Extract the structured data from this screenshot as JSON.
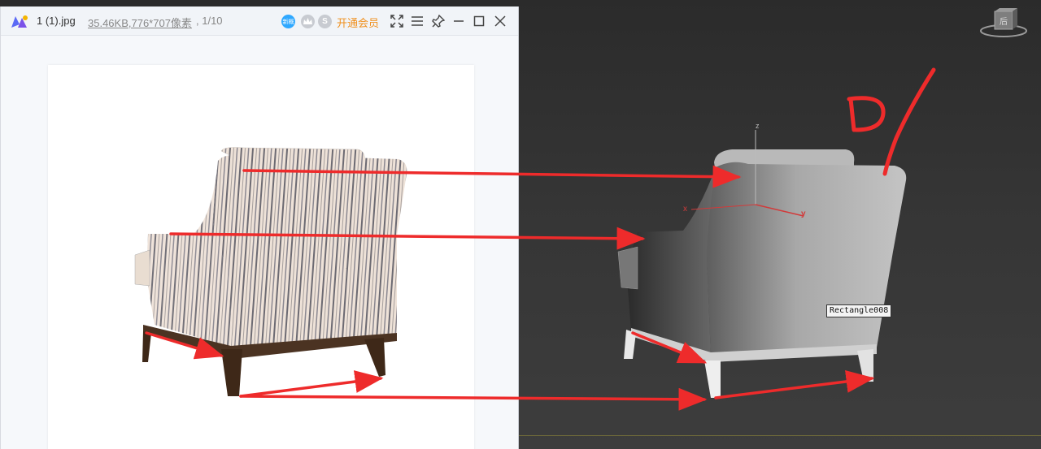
{
  "viewer": {
    "file_name": "1 (1).jpg",
    "file_size": "35.46KB",
    "dimensions": ",776*707像素",
    "index": ", 1/10",
    "badge_text": "新概",
    "badge_s": "S",
    "vip_label": "开通会员"
  },
  "viewport": {
    "object_label": "Rectangle008",
    "axes": {
      "x": "x",
      "y": "y",
      "z": "z"
    },
    "viewcube_label": "后"
  },
  "annotation": {
    "handwritten": "D/",
    "arrow_color": "#ee2b2b"
  },
  "colors": {
    "accent_blue": "#2fa8ff",
    "vip_orange": "#f0901e"
  }
}
